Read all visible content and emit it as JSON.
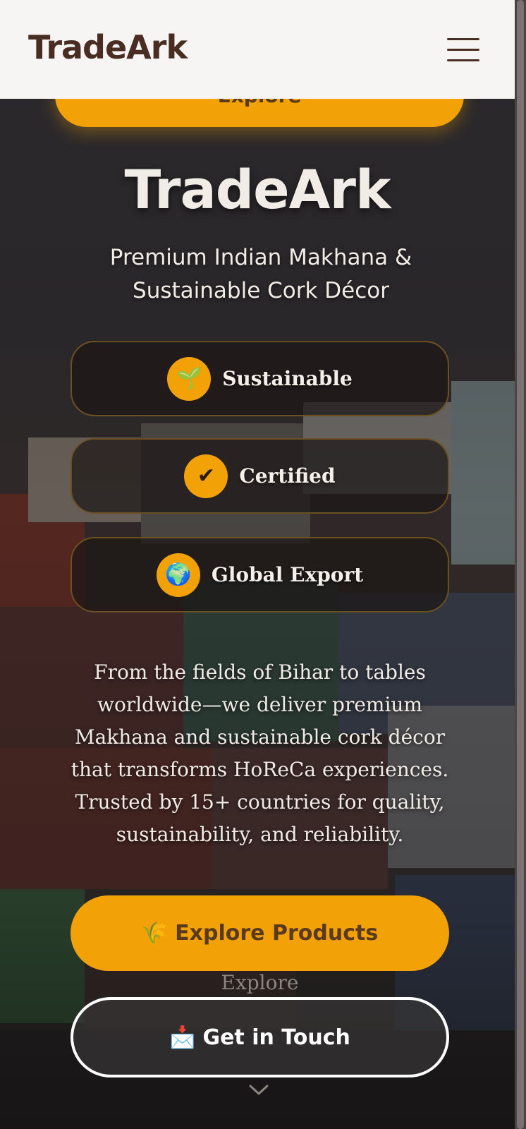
{
  "header": {
    "brand": "TradeArk"
  },
  "top_pill": {
    "label": "Explore"
  },
  "hero": {
    "title": "TradeArk",
    "subtitle": "Premium Indian Makhana & Sustainable Cork Décor"
  },
  "badges": [
    {
      "icon": "🌱",
      "label": "Sustainable"
    },
    {
      "icon": "✔",
      "label": "Certified"
    },
    {
      "icon": "🌍",
      "label": "Global Export"
    }
  ],
  "description": "From the fields of Bihar to tables worldwide—we deliver premium Makhana and sustainable cork décor that transforms HoReCa experiences. Trusted by 15+ countries for quality, sustainability, and reliability.",
  "cta": {
    "primary_icon": "🌾",
    "primary_label": "Explore Products",
    "ghost_label": "Explore",
    "secondary_icon": "📩",
    "secondary_label": "Get in Touch"
  },
  "colors": {
    "accent": "#f2a107",
    "brand_text": "#4a2d22",
    "nav_bg": "#f6f5f3"
  }
}
